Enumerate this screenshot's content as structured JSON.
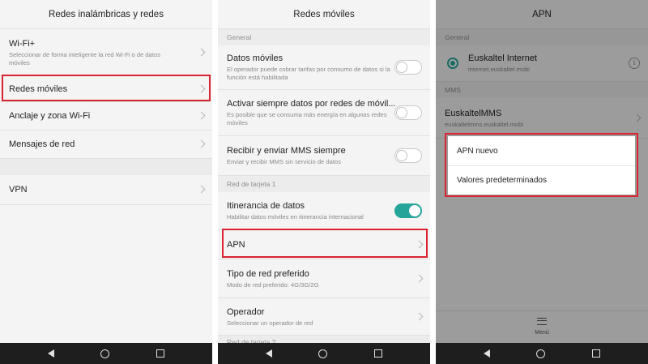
{
  "screens": [
    {
      "title": "Redes inalámbricas y redes",
      "items": [
        {
          "title": "Wi-Fi+",
          "subtitle": "Seleccionar de forma inteligente la red Wi-Fi o de datos móviles"
        },
        {
          "title": "Redes móviles"
        },
        {
          "title": "Anclaje y zona Wi-Fi"
        },
        {
          "title": "Mensajes de red"
        },
        {
          "title": "VPN"
        }
      ]
    },
    {
      "title": "Redes móviles",
      "sections": [
        "General",
        "Red de tarjeta 1",
        "Red de tarjeta 2"
      ],
      "items": [
        {
          "title": "Datos móviles",
          "subtitle": "El operador puede cobrar tarifas por consumo de datos si la función está habilitada",
          "toggle": "off"
        },
        {
          "title": "Activar siempre datos por redes de móvil...",
          "subtitle": "Es posible que se consuma más energía en algunas redes móviles",
          "toggle": "off"
        },
        {
          "title": "Recibir y enviar MMS siempre",
          "subtitle": "Enviar y recibir MMS sin servicio de datos",
          "toggle": "off"
        },
        {
          "title": "Itinerancia de datos",
          "subtitle": "Habilitar datos móviles en itinerancia internacional",
          "toggle": "on"
        },
        {
          "title": "APN"
        },
        {
          "title": "Tipo de red preferido",
          "subtitle": "Modo de red preferido: 4G/3G/2G"
        },
        {
          "title": "Operador",
          "subtitle": "Seleccionar un operador de red"
        }
      ]
    },
    {
      "title": "APN",
      "sections": [
        "General",
        "MMS"
      ],
      "apns": [
        {
          "name": "Euskaltel Internet",
          "value": "internet.euskaltel.mobi"
        },
        {
          "name": "EuskaltelMMS",
          "value": "euskaltelmms.euskaltel.mobi"
        }
      ],
      "menu_options": [
        "APN nuevo",
        "Valores predeterminados"
      ],
      "menu_label": "Menú"
    }
  ],
  "colors": {
    "highlight": "#d92431",
    "accent": "#25a59a",
    "navbar": "#1e1e1e"
  },
  "icons": [
    "chevron-right-icon",
    "back-icon",
    "home-icon",
    "recent-apps-icon",
    "info-icon",
    "menu-icon"
  ]
}
